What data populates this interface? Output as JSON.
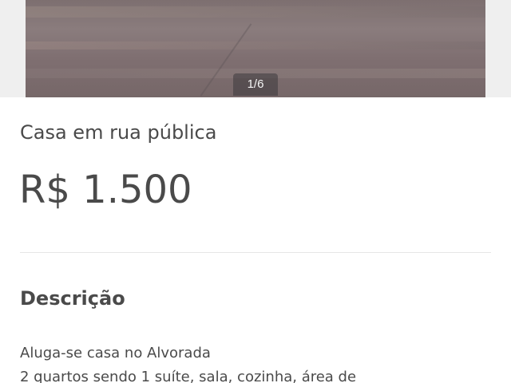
{
  "gallery": {
    "counter": "1/6",
    "current_photo": 1,
    "total_photos": 6
  },
  "listing": {
    "title": "Casa em rua pública",
    "price": "R$ 1.500"
  },
  "description": {
    "heading": "Descrição",
    "lines": [
      "Aluga-se casa no Alvorada",
      "2 quartos sendo 1 suíte, sala, cozinha, área de"
    ]
  }
}
